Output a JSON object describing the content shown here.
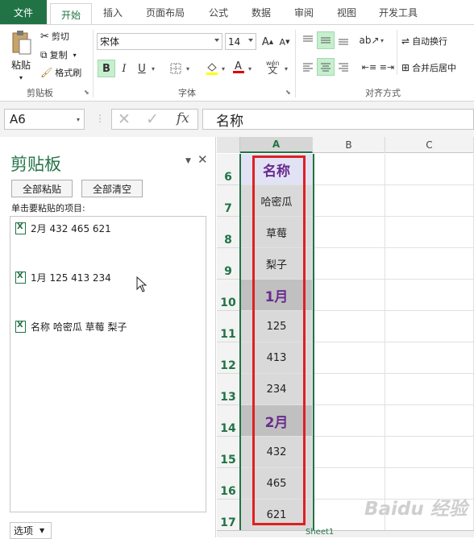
{
  "tabs": [
    "文件",
    "开始",
    "插入",
    "页面布局",
    "公式",
    "数据",
    "审阅",
    "视图",
    "开发工具"
  ],
  "ribbon": {
    "paste_label": "粘贴",
    "cut_label": "剪切",
    "copy_label": "复制",
    "format_painter_label": "格式刷",
    "clipboard_group": "剪贴板",
    "font_name": "宋体",
    "font_size": "14",
    "bold": "B",
    "italic": "I",
    "underline": "U",
    "font_group": "字体",
    "wen_label": "wén",
    "wrap_text_label": "自动换行",
    "merge_center_label": "合并后居中",
    "alignment_group": "对齐方式"
  },
  "formula_bar": {
    "name_box": "A6",
    "fx": "fx",
    "content": "名称"
  },
  "clipboard_pane": {
    "title": "剪贴板",
    "paste_all": "全部粘贴",
    "clear_all": "全部清空",
    "instruction": "单击要粘贴的项目:",
    "items": [
      "2月 432 465 621",
      "1月 125 413 234",
      "名称 哈密瓜 草莓 梨子"
    ],
    "options_label": "选项"
  },
  "grid": {
    "columns": [
      "A",
      "B",
      "C"
    ],
    "rows": [
      {
        "num": "6",
        "a": "名称"
      },
      {
        "num": "7",
        "a": "哈密瓜"
      },
      {
        "num": "8",
        "a": "草莓"
      },
      {
        "num": "9",
        "a": "梨子"
      },
      {
        "num": "10",
        "a": "1月"
      },
      {
        "num": "11",
        "a": "125"
      },
      {
        "num": "12",
        "a": "413"
      },
      {
        "num": "13",
        "a": "234"
      },
      {
        "num": "14",
        "a": "2月"
      },
      {
        "num": "15",
        "a": "432"
      },
      {
        "num": "16",
        "a": "465"
      },
      {
        "num": "17",
        "a": "621"
      }
    ]
  },
  "sheet_tab": "Sheet1",
  "watermark": "Baidu 经验",
  "colors": {
    "accent": "#217346",
    "header_text": "#6a2c8e",
    "highlight": "#e02020"
  }
}
